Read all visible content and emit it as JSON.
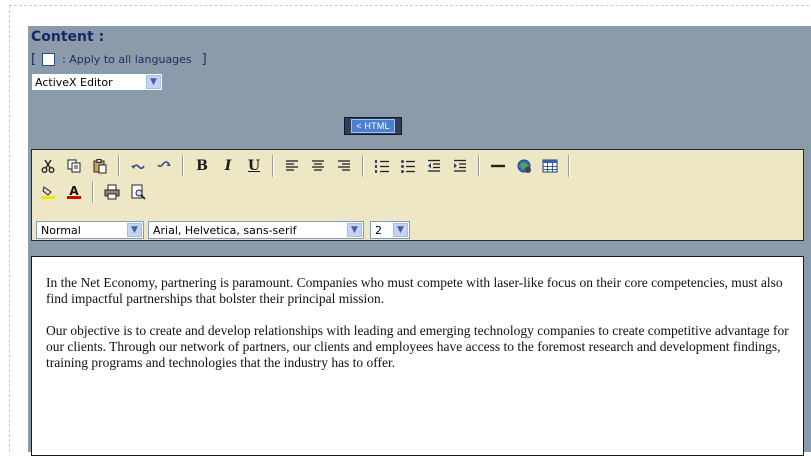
{
  "content_label": "Content :",
  "apply_all": {
    "bracket_open": "[",
    "colon_label": ": Apply to all languages",
    "bracket_close": "]",
    "checked": false
  },
  "editor_select": {
    "value": "ActiveX Editor"
  },
  "html_button": {
    "label": "HTML"
  },
  "toolbar": {
    "row1": [
      "cut-icon",
      "copy-icon",
      "paste-icon",
      "undo-icon",
      "redo-icon",
      "bold",
      "italic",
      "underline",
      "align-left-icon",
      "align-center-icon",
      "align-right-icon",
      "ordered-list-icon",
      "unordered-list-icon",
      "outdent-icon",
      "indent-icon",
      "horizontal-rule-icon",
      "link-icon",
      "table-icon"
    ],
    "bold_label": "B",
    "italic_label": "I",
    "underline_label": "U",
    "row2": [
      "highlight-color-icon",
      "font-color-icon",
      "print-icon",
      "print-preview-icon"
    ],
    "font_color_letter": "A",
    "format_select": "Normal",
    "font_select": "Arial, Helvetica, sans-serif",
    "size_select": "2"
  },
  "content": {
    "paragraph1": "In the Net Economy, partnering is paramount. Companies who must compete with laser-like focus on their core competencies, must also find impactful partnerships that bolster their principal mission.",
    "paragraph2": "Our objective is to create and develop relationships with leading and emerging technology companies to create competitive advantage for our clients. Through our network of partners, our clients and employees have access to the foremost research and development findings, training programs and technologies that the industry has to offer."
  },
  "colors": {
    "panel": "#8c9ba9",
    "toolbar": "#ede7c6",
    "title": "#152a62"
  }
}
